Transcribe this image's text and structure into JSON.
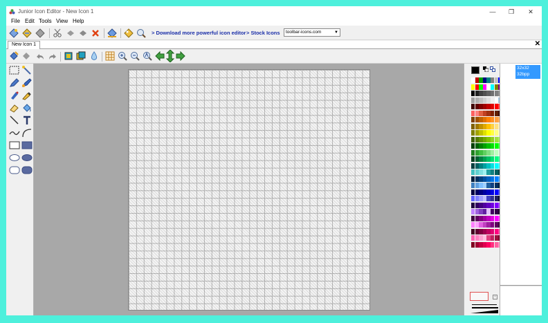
{
  "window": {
    "title": "Junior Icon Editor - New Icon 1",
    "controls": {
      "minimize": "—",
      "maximize": "❐",
      "close": "✕"
    }
  },
  "menu": [
    "File",
    "Edit",
    "Tools",
    "View",
    "Help"
  ],
  "toolbar": {
    "links": [
      "> Download more powerful icon editor",
      "> Stock Icons"
    ],
    "stock_select_value": "toolbar-icons.com"
  },
  "tabs": [
    {
      "label": "New Icon 1"
    }
  ],
  "tab_close": "✕",
  "image_format": {
    "size": "32x32",
    "depth": "32bpp"
  },
  "palette": {
    "foreground": "#000000",
    "rows": [
      [
        "#ffffff",
        "#c00000",
        "#00a000",
        "#000080",
        "#008080",
        "#808080",
        "#c0c0c0",
        "#0000ff"
      ],
      [
        "#ffff00",
        "#ff0000",
        "#00ff00",
        "#ff00ff",
        "#ffffff",
        "#00ffff",
        "#808000",
        "#800080"
      ],
      [
        "#000000",
        "#202020",
        "#404040",
        "#505050",
        "#606060",
        "#707070",
        "#808080",
        "#909090"
      ],
      [
        "#a0a0a0",
        "#b0b0b0",
        "#c0c0c0",
        "#d0d0d0",
        "#e0e0e0",
        "#f0f0f0",
        "#ffffff",
        "#a8c8e0"
      ],
      [
        "#400000",
        "#600000",
        "#800000",
        "#a00000",
        "#c00000",
        "#e00000",
        "#ff0000",
        "#ff4040"
      ],
      [
        "#ff6060",
        "#ff8080",
        "#e06040",
        "#c04020",
        "#a03010",
        "#802000",
        "#602000",
        "#401000"
      ],
      [
        "#804000",
        "#a05000",
        "#c06000",
        "#e07000",
        "#ff8000",
        "#ff9020",
        "#ffa040",
        "#ffb060"
      ],
      [
        "#806000",
        "#a07800",
        "#c09000",
        "#e0a800",
        "#ffc000",
        "#ffd040",
        "#ffe080",
        "#fff0c0"
      ],
      [
        "#808000",
        "#a0a000",
        "#c0c000",
        "#e0e000",
        "#ffff00",
        "#ffff40",
        "#ffff80",
        "#ffffc0"
      ],
      [
        "#406000",
        "#507800",
        "#609000",
        "#70a800",
        "#80c000",
        "#90d020",
        "#a0e040",
        "#b0f060"
      ],
      [
        "#004000",
        "#006000",
        "#008000",
        "#00a000",
        "#00c000",
        "#00e000",
        "#00ff00",
        "#40ff40"
      ],
      [
        "#208020",
        "#30a030",
        "#40c040",
        "#60d060",
        "#80e080",
        "#a0f0a0",
        "#c0ffc0",
        "#e0ffe0"
      ],
      [
        "#004020",
        "#006030",
        "#008040",
        "#00a050",
        "#00c060",
        "#00e070",
        "#00ff80",
        "#40ffa0"
      ],
      [
        "#004040",
        "#006060",
        "#008080",
        "#00a0a0",
        "#00c0c0",
        "#00e0e0",
        "#00ffff",
        "#40ffff"
      ],
      [
        "#40c0c0",
        "#60d0d0",
        "#80e0e0",
        "#a0f0f0",
        "#20a0a0",
        "#108080",
        "#006060",
        "#004848"
      ],
      [
        "#002040",
        "#003060",
        "#004080",
        "#0050a0",
        "#0060c0",
        "#0070e0",
        "#0080ff",
        "#40a0ff"
      ],
      [
        "#4080c0",
        "#60a0e0",
        "#80c0ff",
        "#a0d0ff",
        "#2060a0",
        "#104080",
        "#003060",
        "#002040"
      ],
      [
        "#000040",
        "#000060",
        "#000080",
        "#0000a0",
        "#0000c0",
        "#0000e0",
        "#0000ff",
        "#4040ff"
      ],
      [
        "#6060ff",
        "#8080ff",
        "#a0a0ff",
        "#c0c0ff",
        "#4040c0",
        "#303090",
        "#202060",
        "#101030"
      ],
      [
        "#200040",
        "#300060",
        "#400080",
        "#5000a0",
        "#6000c0",
        "#7000e0",
        "#8000ff",
        "#a040ff"
      ],
      [
        "#c080ff",
        "#a060e0",
        "#8040c0",
        "#6020a0",
        "#e0c0ff",
        "#400060",
        "#300048",
        "#200030"
      ],
      [
        "#400040",
        "#600060",
        "#800080",
        "#a000a0",
        "#c000c0",
        "#e000e0",
        "#ff00ff",
        "#ff40ff"
      ],
      [
        "#ff80ff",
        "#ffa0ff",
        "#e060e0",
        "#c040c0",
        "#a020a0",
        "#800080",
        "#600060",
        "#400040"
      ],
      [
        "#400020",
        "#600030",
        "#800040",
        "#a00050",
        "#c00060",
        "#e00070",
        "#ff0080",
        "#ff40a0"
      ],
      [
        "#ff60b0",
        "#ff80c0",
        "#ffa0d0",
        "#ffc0e0",
        "#e04080",
        "#c02060",
        "#a01040",
        "#800030"
      ],
      [
        "#800020",
        "#a00030",
        "#c00040",
        "#e00050",
        "#ff0060",
        "#ff3080",
        "#ff60a0",
        "#ff90c0"
      ]
    ]
  }
}
